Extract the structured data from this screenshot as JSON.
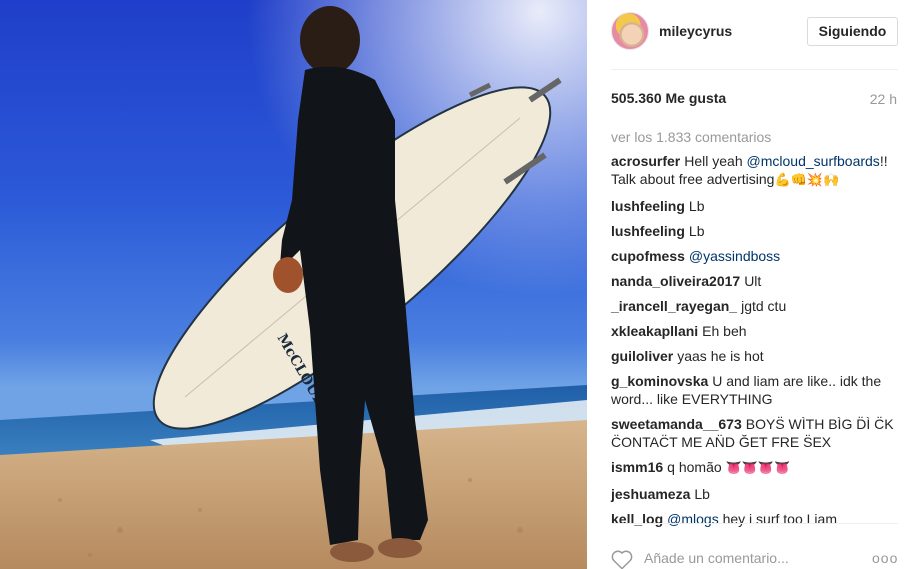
{
  "post": {
    "username": "mileycyrus",
    "follow_label": "Siguiendo",
    "likes": "505.360 Me gusta",
    "time": "22 h",
    "view_all": "ver los 1.833 comentarios",
    "board_brand": "McCLOUD"
  },
  "comments": [
    {
      "user": "acrosurfer",
      "pre": "Hell yeah ",
      "mention": "@mcloud_surfboards",
      "post": "!! Talk about free advertising",
      "emoji": "💪👊💥🙌"
    },
    {
      "user": "lushfeeling",
      "pre": "Lb",
      "mention": "",
      "post": "",
      "emoji": ""
    },
    {
      "user": "lushfeeling",
      "pre": "Lb",
      "mention": "",
      "post": "",
      "emoji": ""
    },
    {
      "user": "cupofmess",
      "pre": "",
      "mention": "@yassindboss",
      "post": "",
      "emoji": ""
    },
    {
      "user": "nanda_oliveira2017",
      "pre": "Ult",
      "mention": "",
      "post": "",
      "emoji": ""
    },
    {
      "user": "_irancell_rayegan_",
      "pre": "jgtd ctu",
      "mention": "",
      "post": "",
      "emoji": ""
    },
    {
      "user": "xkleakapllani",
      "pre": "Eh beh",
      "mention": "",
      "post": "",
      "emoji": ""
    },
    {
      "user": "guiloliver",
      "pre": "yaas he is hot",
      "mention": "",
      "post": "",
      "emoji": ""
    },
    {
      "user": "g_kominovska",
      "pre": "U and liam are like.. idk the word... like EVERYTHING",
      "mention": "",
      "post": "",
      "emoji": ""
    },
    {
      "user": "sweetamanda__673",
      "pre": "BOYS̈ WÌTH BÌG D̈Ì C̈K C̈ONTAC̈T ME AN̈D ĞET FRE S̈EX",
      "mention": "",
      "post": "",
      "emoji": ""
    },
    {
      "user": "ismm16",
      "pre": "q homão ",
      "mention": "",
      "post": "",
      "emoji": "👅👅👅👅"
    },
    {
      "user": "jeshuameza",
      "pre": "Lb",
      "mention": "",
      "post": "",
      "emoji": ""
    },
    {
      "user": "kell_log",
      "pre": "",
      "mention": "@mlogs",
      "post": " hey i surf too Liam",
      "emoji": ""
    }
  ],
  "footer": {
    "add_comment_placeholder": "Añade un comentario...",
    "more_label": "ooo"
  },
  "icons": {
    "heart": "heart-icon",
    "more": "more-options-icon"
  },
  "colors": {
    "sky": "#2c5ad8",
    "mention": "#003569",
    "muted": "#999999"
  }
}
